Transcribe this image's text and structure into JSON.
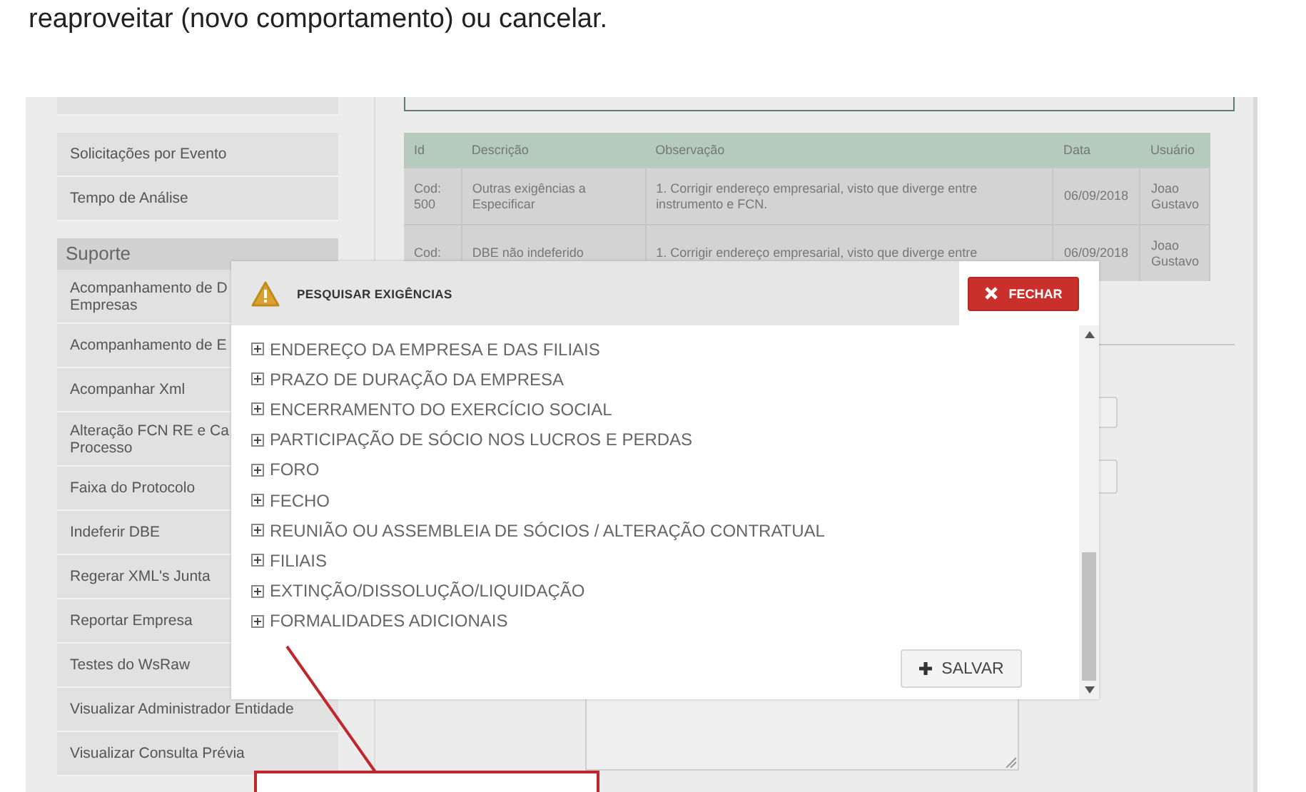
{
  "document": {
    "text": "reaproveitar (novo comportamento) ou cancelar."
  },
  "sidebar": {
    "items": [
      {
        "lines": [
          "Solicitações por Evento"
        ]
      },
      {
        "lines": [
          "Tempo de Análise"
        ]
      }
    ],
    "section": {
      "title": "Suporte",
      "items": [
        {
          "lines": [
            "Acompanhamento de D",
            "Empresas"
          ]
        },
        {
          "lines": [
            "Acompanhamento de E"
          ]
        },
        {
          "lines": [
            "Acompanhar Xml"
          ]
        },
        {
          "lines": [
            "Alteração FCN RE e Ca",
            "Processo"
          ]
        },
        {
          "lines": [
            "Faixa do Protocolo"
          ]
        },
        {
          "lines": [
            "Indeferir DBE"
          ]
        },
        {
          "lines": [
            "Regerar XML's Junta"
          ]
        },
        {
          "lines": [
            "Reportar Empresa"
          ]
        },
        {
          "lines": [
            "Testes do WsRaw"
          ]
        },
        {
          "lines": [
            "Visualizar Administrador Entidade"
          ]
        },
        {
          "lines": [
            "Visualizar Consulta Prévia"
          ]
        }
      ]
    }
  },
  "table": {
    "columns": [
      "Id",
      "Descrição",
      "Observação",
      "Data",
      "Usuário"
    ],
    "rows": [
      [
        "Cod: 500",
        "Outras exigências a Especificar",
        "1. Corrigir endereço empresarial, visto que diverge entre instrumento e FCN.",
        "06/09/2018",
        "Joao Gustavo"
      ],
      [
        "Cod:",
        "DBE não indeferido",
        "1. Corrigir endereço empresarial, visto que diverge entre",
        "06/09/2018",
        "Joao Gustavo"
      ]
    ]
  },
  "modal": {
    "title": "PESQUISAR EXIGÊNCIAS",
    "close_button": "FECHAR",
    "tree": [
      {
        "label": "ENDEREÇO DA EMPRESA E DAS FILIAIS",
        "expanded": false
      },
      {
        "label": "PRAZO DE DURAÇÃO DA EMPRESA",
        "expanded": false
      },
      {
        "label": "ENCERRAMENTO DO EXERCÍCIO SOCIAL",
        "expanded": false
      },
      {
        "label": "PARTICIPAÇÃO DE SÓCIO NOS LUCROS E PERDAS",
        "expanded": false
      },
      {
        "label": "FORO",
        "expanded": false
      },
      {
        "label": "FECHO",
        "expanded": false
      },
      {
        "label": "REUNIÃO OU ASSEMBLEIA DE SÓCIOS / ALTERAÇÃO CONTRATUAL",
        "expanded": false
      },
      {
        "label": "FILIAIS",
        "expanded": false
      },
      {
        "label": "EXTINÇÃO/DISSOLUÇÃO/LIQUIDAÇÃO",
        "expanded": false
      },
      {
        "label": "FORMALIDADES ADICIONAIS",
        "expanded": false
      }
    ],
    "save_button": "SALVAR"
  }
}
